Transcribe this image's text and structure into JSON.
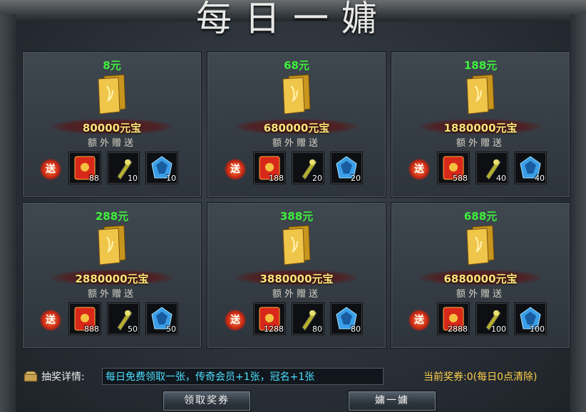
{
  "window": {
    "title": "每日一嫞"
  },
  "cards": [
    {
      "price": "8元",
      "amount": "80000元宝",
      "extra_label": "额外赠送",
      "gift_badge": "送",
      "items": [
        "88",
        "10",
        "10"
      ]
    },
    {
      "price": "68元",
      "amount": "680000元宝",
      "extra_label": "额外赠送",
      "gift_badge": "送",
      "items": [
        "188",
        "20",
        "20"
      ]
    },
    {
      "price": "188元",
      "amount": "1880000元宝",
      "extra_label": "额外赠送",
      "gift_badge": "送",
      "items": [
        "588",
        "40",
        "40"
      ]
    },
    {
      "price": "288元",
      "amount": "2880000元宝",
      "extra_label": "额外赠送",
      "gift_badge": "送",
      "items": [
        "888",
        "50",
        "50"
      ]
    },
    {
      "price": "388元",
      "amount": "3880000元宝",
      "extra_label": "额外赠送",
      "gift_badge": "送",
      "items": [
        "1288",
        "80",
        "80"
      ]
    },
    {
      "price": "688元",
      "amount": "6880000元宝",
      "extra_label": "额外赠送",
      "gift_badge": "送",
      "items": [
        "2888",
        "100",
        "100"
      ]
    }
  ],
  "item_icons": [
    "red-envelope-icon",
    "scroll-icon",
    "blue-gem-icon"
  ],
  "footer": {
    "detail_label": "抽奖详情:",
    "detail_text": "每日免费领取一张，传奇会员+1张，冠名+1张",
    "ticket_status": "当前奖券:0(每日0点清除)",
    "claim_button": "领取奖券",
    "draw_button": "嫞一嫞"
  },
  "colors": {
    "price": "#3ef03c",
    "amount": "#ffe57a",
    "detail_text": "#4ae0ff",
    "ticket_status": "#ffd04a"
  }
}
